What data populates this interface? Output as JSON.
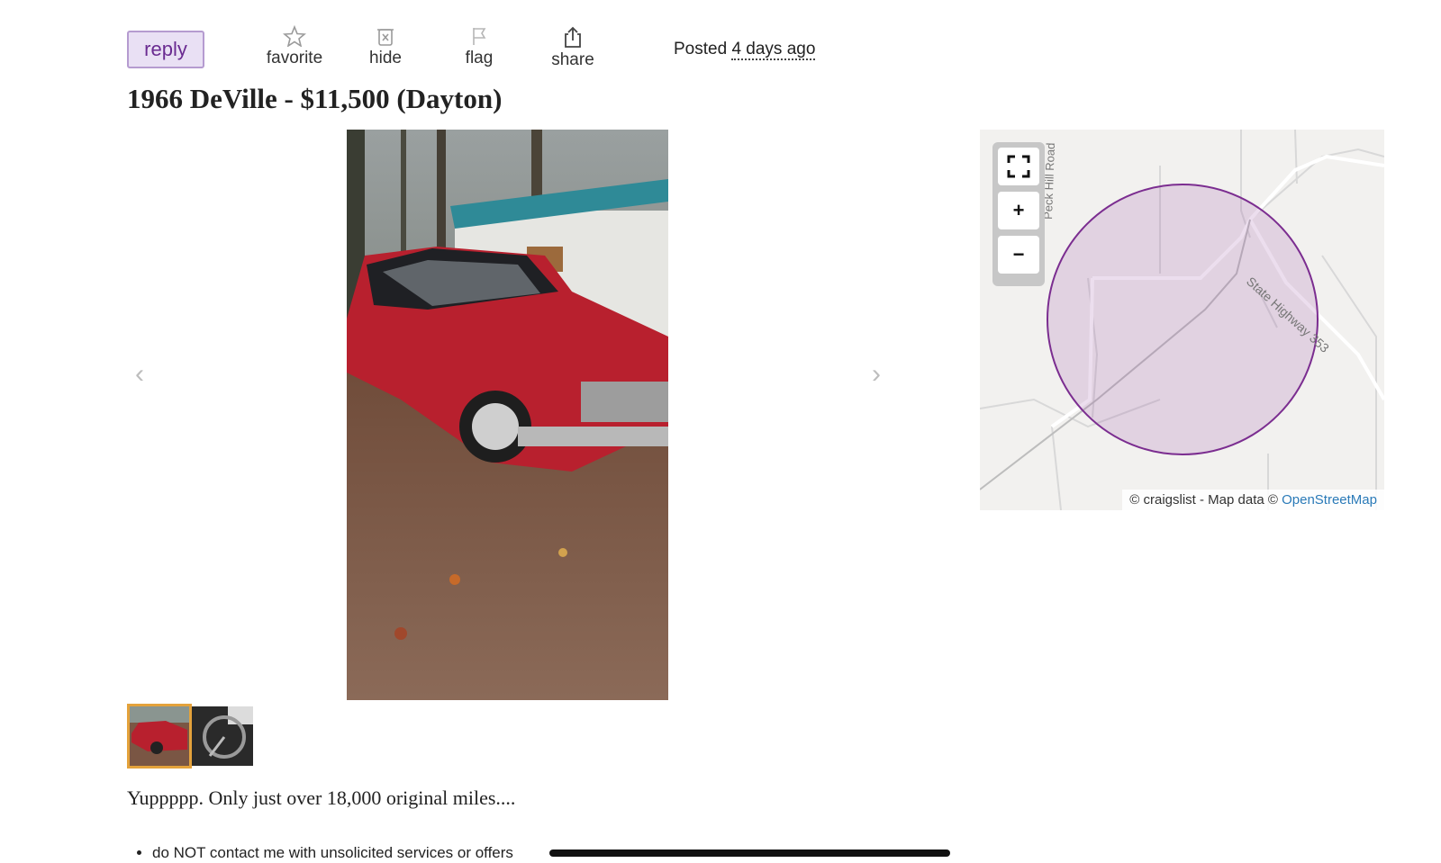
{
  "actions": {
    "reply": "reply",
    "favorite": "favorite",
    "hide": "hide",
    "flag": "flag",
    "share": "share"
  },
  "posted": {
    "prefix": "Posted",
    "time": "4 days ago"
  },
  "title": "1966 DeVille - $11,500 (Dayton)",
  "gallery": {
    "prev_icon": "chevron-left-icon",
    "next_icon": "chevron-right-icon",
    "thumbnail_count": 2,
    "selected_thumbnail": 1
  },
  "map": {
    "roads": [
      "Peck Hill Road",
      "State Highway 353"
    ],
    "controls": [
      "fullscreen-icon",
      "zoom-in-icon",
      "zoom-out-icon"
    ],
    "attribution_text": "© craigslist - Map data ©",
    "attribution_link": "OpenStreetMap",
    "circle_color": "#7b2d90"
  },
  "description": "Yuppppp. Only just over 18,000 original miles....",
  "notices": [
    "do NOT contact me with unsolicited services or offers"
  ]
}
